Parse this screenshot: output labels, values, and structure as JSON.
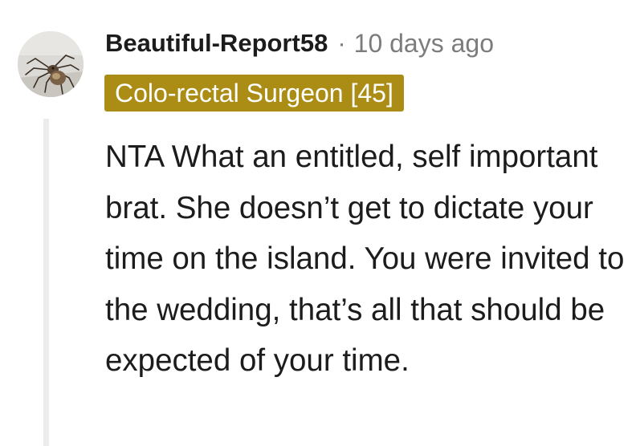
{
  "comment": {
    "author": "Beautiful-Report58",
    "separator": "·",
    "timestamp": "10 days ago",
    "flair": "Colo-rectal Surgeon [45]",
    "body": "NTA What an entitled, self important brat. She doesn’t get to dictate your time on the island. You were invited to the wedding, that’s all that should be expected of your time.",
    "avatar_icon": "spider-icon"
  },
  "colors": {
    "flair_background": "#ab8d16",
    "flair_text": "#ffffff",
    "username": "#1c1c1c",
    "meta_text": "#7c7c7c",
    "body_text": "#1c1c1c",
    "thread_line": "#ececec"
  }
}
